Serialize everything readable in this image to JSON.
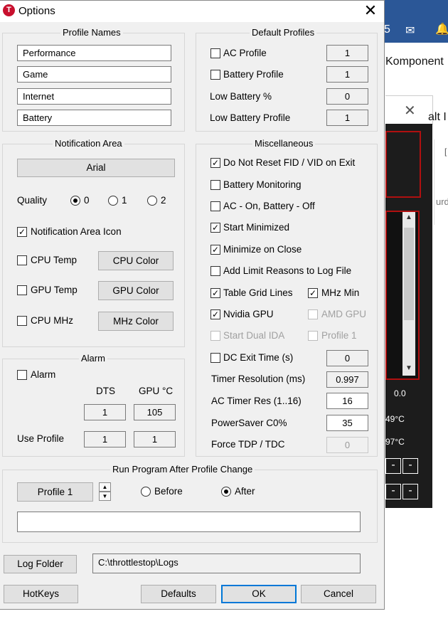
{
  "background": {
    "header_number": "5",
    "text1": "Komponent",
    "text2": "alt I",
    "text3": "urd",
    "text4": "[",
    "v1": "0.0",
    "v2": "49°C",
    "v3": "97°C",
    "minus": "-"
  },
  "dialog": {
    "title": "Options",
    "icon_letter": "T"
  },
  "profile_names": {
    "title": "Profile Names",
    "names": [
      "Performance",
      "Game",
      "Internet",
      "Battery"
    ]
  },
  "default_profiles": {
    "title": "Default Profiles",
    "ac_profile": {
      "label": "AC Profile",
      "value": "1",
      "checked": false
    },
    "battery_profile": {
      "label": "Battery Profile",
      "value": "1",
      "checked": false
    },
    "low_battery_pct": {
      "label": "Low Battery %",
      "value": "0"
    },
    "low_battery_profile": {
      "label": "Low Battery Profile",
      "value": "1"
    }
  },
  "notification": {
    "title": "Notification Area",
    "font_button": "Arial",
    "quality_label": "Quality",
    "quality_options": [
      "0",
      "1",
      "2"
    ],
    "quality_selected": "0",
    "icon_label": "Notification Area Icon",
    "cpu_temp": "CPU Temp",
    "cpu_color": "CPU Color",
    "gpu_temp": "GPU Temp",
    "gpu_color": "GPU Color",
    "cpu_mhz": "CPU MHz",
    "mhz_color": "MHz Color"
  },
  "alarm": {
    "title": "Alarm",
    "alarm_label": "Alarm",
    "col_dts": "DTS",
    "col_gpu": "GPU °C",
    "dts_value": "1",
    "gpu_value": "105",
    "use_profile_label": "Use Profile",
    "use_profile_dts": "1",
    "use_profile_gpu": "1"
  },
  "misc": {
    "title": "Miscellaneous",
    "do_not_reset": "Do Not Reset FID / VID on Exit",
    "battery_monitoring": "Battery Monitoring",
    "ac_on_battery_off": "AC - On, Battery - Off",
    "start_minimized": "Start Minimized",
    "minimize_on_close": "Minimize on Close",
    "add_limit_reasons": "Add Limit Reasons to Log File",
    "table_grid_lines": "Table Grid Lines",
    "mhz_min": "MHz Min",
    "nvidia_gpu": "Nvidia GPU",
    "amd_gpu": "AMD GPU",
    "start_dual_ida": "Start Dual IDA",
    "profile_1": "Profile 1",
    "dc_exit_time": "DC Exit Time (s)",
    "dc_exit_value": "0",
    "timer_resolution": "Timer Resolution (ms)",
    "timer_resolution_value": "0.997",
    "ac_timer_res": "AC Timer Res (1..16)",
    "ac_timer_res_value": "16",
    "powersaver": "PowerSaver C0%",
    "powersaver_value": "35",
    "force_tdp": "Force TDP / TDC",
    "force_tdp_value": "0"
  },
  "run_program": {
    "title": "Run Program After Profile Change",
    "profile_button": "Profile 1",
    "before": "Before",
    "after": "After",
    "selected": "After",
    "path_value": ""
  },
  "footer": {
    "log_folder_button": "Log Folder",
    "log_path": "C:\\throttlestop\\Logs",
    "hotkeys": "HotKeys",
    "defaults": "Defaults",
    "ok": "OK",
    "cancel": "Cancel"
  },
  "colors": {
    "accent": "#0078d7",
    "background_header": "#2b5797",
    "background_panel": "#1e1e1e",
    "alert_red": "#b01010",
    "icon_red": "#c8102e"
  }
}
